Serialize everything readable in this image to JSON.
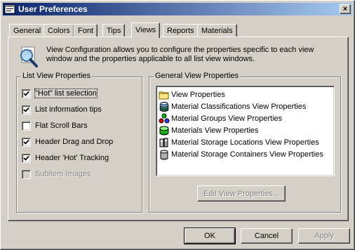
{
  "window": {
    "title": "User Preferences",
    "close_glyph": "×"
  },
  "tabs": [
    {
      "label": "General",
      "active": false
    },
    {
      "label": "Colors",
      "active": false
    },
    {
      "label": "Font",
      "active": false
    },
    {
      "label": "Tips",
      "active": false
    },
    {
      "label": "Views",
      "active": true
    },
    {
      "label": "Reports",
      "active": false
    },
    {
      "label": "Materials",
      "active": false
    }
  ],
  "views_tab": {
    "description": "View Configuration allows you to configure the properties specific to each view window and the properties applicable to all list view windows.",
    "list_view_properties": {
      "label": "List View Properties",
      "options": [
        {
          "label": "\"Hot\" list selection",
          "checked": true,
          "enabled": true,
          "focused": true
        },
        {
          "label": "List information tips",
          "checked": true,
          "enabled": true,
          "focused": false
        },
        {
          "label": "Flat Scroll Bars",
          "checked": false,
          "enabled": true,
          "focused": false
        },
        {
          "label": "Header Drag and Drop",
          "checked": true,
          "enabled": true,
          "focused": false
        },
        {
          "label": "Header 'Hot' Tracking",
          "checked": true,
          "enabled": true,
          "focused": false
        },
        {
          "label": "Subitem Images",
          "checked": false,
          "enabled": false,
          "focused": false
        }
      ]
    },
    "general_view_properties": {
      "label": "General View Properties",
      "items": [
        {
          "label": "View Properties",
          "icon": "folder-icon"
        },
        {
          "label": "Material Classifications View Properties",
          "icon": "stack-icon"
        },
        {
          "label": "Material Groups View Properties",
          "icon": "groups-icon"
        },
        {
          "label": "Materials View Properties",
          "icon": "material-icon"
        },
        {
          "label": "Material Storage Locations View Properties",
          "icon": "locations-icon"
        },
        {
          "label": "Material Storage Containers View Properties",
          "icon": "container-icon"
        }
      ],
      "edit_button": "Edit View Properties..."
    }
  },
  "buttons": {
    "ok": "OK",
    "cancel": "Cancel",
    "apply": "Apply"
  }
}
